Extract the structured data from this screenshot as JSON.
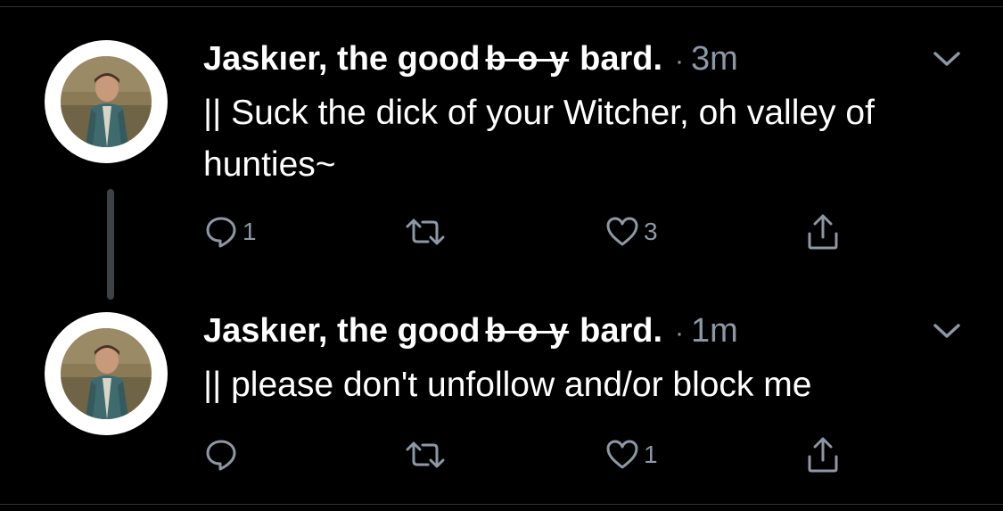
{
  "theme": {
    "background": "#000000",
    "text": "#ffffff",
    "secondary": "#8b98a5",
    "divider": "#2f3336",
    "thread_line": "#3d4247"
  },
  "tweets": [
    {
      "name_prefix": "Jaskıer, the good",
      "name_struck": "b o y",
      "name_suffix": "bard.",
      "separator": "·",
      "time": "3m",
      "text": "|| Suck the dick of your Witcher, oh valley of hunties~",
      "reply_count": "1",
      "retweet_count": "",
      "like_count": "3",
      "icons": [
        "reply-icon",
        "retweet-icon",
        "like-icon",
        "share-icon",
        "chevron-down-icon"
      ]
    },
    {
      "name_prefix": "Jaskıer, the good",
      "name_struck": "b o y",
      "name_suffix": "bard.",
      "separator": "·",
      "time": "1m",
      "text": "|| please don't unfollow and/or block me",
      "reply_count": "",
      "retweet_count": "",
      "like_count": "1",
      "icons": [
        "reply-icon",
        "retweet-icon",
        "like-icon",
        "share-icon",
        "chevron-down-icon"
      ]
    }
  ]
}
